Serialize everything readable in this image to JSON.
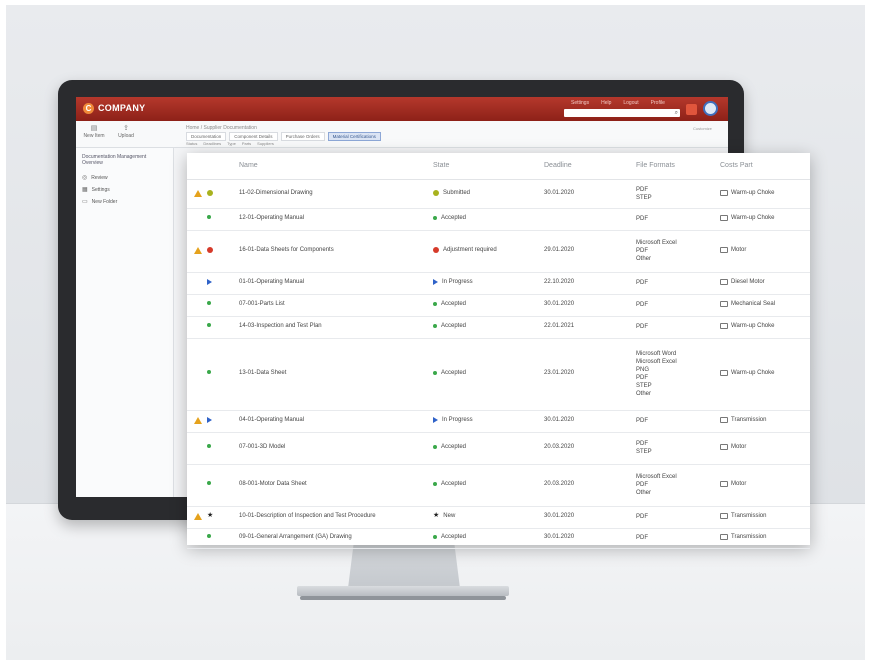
{
  "app": {
    "logo_text": "COMPANY",
    "top_links": [
      "Settings",
      "Help",
      "Logout",
      "Profile"
    ],
    "colors": {
      "brand": "#a22c22",
      "accent": "#3f6ebc"
    }
  },
  "toolbar": {
    "buttons": [
      {
        "label": "New Item",
        "icon": "document-icon"
      },
      {
        "label": "Upload",
        "icon": "upload-icon"
      }
    ],
    "breadcrumb": "Home / Supplier Documentation",
    "tabs": [
      "Documentation",
      "Component Details",
      "Purchase Orders",
      "Material Certifications"
    ],
    "active_tab": 3,
    "subtabs": [
      "Status",
      "Deadlines",
      "Type",
      "Parts",
      "Suppliers"
    ],
    "top_right_label": "Customize"
  },
  "sidebar": {
    "title": "Documentation Management Overview",
    "items": [
      {
        "label": "Review",
        "icon": "review-icon"
      },
      {
        "label": "Settings",
        "icon": "grid-icon"
      },
      {
        "label": "New Folder",
        "icon": "folder-icon"
      }
    ]
  },
  "table": {
    "headers": [
      "Name",
      "State",
      "Deadline",
      "File Formats",
      "Costs Part"
    ],
    "rows": [
      {
        "warning": true,
        "status_color": "#a8b21e",
        "dot_shape": "circle",
        "name": "11-02-Dimensional Drawing",
        "state": "Submitted",
        "deadline": "30.01.2020",
        "formats": [
          "PDF",
          "STEP"
        ],
        "part": "Warm-up Choke"
      },
      {
        "warning": false,
        "status_color": "#3aa84a",
        "dot_shape": "small",
        "name": "12-01-Operating Manual",
        "state": "Accepted",
        "deadline": "",
        "formats": [
          "PDF"
        ],
        "part": "Warm-up Choke"
      },
      {
        "warning": true,
        "status_color": "#d63a2a",
        "dot_shape": "circle",
        "name": "16-01-Data Sheets for Components",
        "state": "Adjustment required",
        "deadline": "29.01.2020",
        "formats": [
          "Microsoft Excel",
          "PDF",
          "Other"
        ],
        "part": "Motor"
      },
      {
        "warning": false,
        "status_color": "#2f62c8",
        "dot_shape": "arrow",
        "name": "01-01-Operating Manual",
        "state": "In Progress",
        "deadline": "22.10.2020",
        "formats": [
          "PDF"
        ],
        "part": "Diesel Motor"
      },
      {
        "warning": false,
        "status_color": "#3aa84a",
        "dot_shape": "small",
        "name": "07-001-Parts List",
        "state": "Accepted",
        "deadline": "30.01.2020",
        "formats": [
          "PDF"
        ],
        "part": "Mechanical Seal"
      },
      {
        "warning": false,
        "status_color": "#3aa84a",
        "dot_shape": "small",
        "name": "14-03-Inspection and Test Plan",
        "state": "Accepted",
        "deadline": "22.01.2021",
        "formats": [
          "PDF"
        ],
        "part": "Warm-up Choke"
      },
      {
        "warning": false,
        "status_color": "#3aa84a",
        "dot_shape": "small",
        "name": "13-01-Data Sheet",
        "state": "Accepted",
        "deadline": "23.01.2020",
        "formats": [
          "Microsoft Word",
          "Microsoft Excel",
          "PNG",
          "PDF",
          "STEP",
          "Other"
        ],
        "part": "Warm-up Choke"
      },
      {
        "warning": true,
        "status_color": "#2f62c8",
        "dot_shape": "arrow",
        "name": "04-01-Operating Manual",
        "state": "In Progress",
        "deadline": "30.01.2020",
        "formats": [
          "PDF"
        ],
        "part": "Transmission"
      },
      {
        "warning": false,
        "status_color": "#3aa84a",
        "dot_shape": "small",
        "name": "07-001-3D Model",
        "state": "Accepted",
        "deadline": "20.03.2020",
        "formats": [
          "PDF",
          "STEP"
        ],
        "part": "Motor"
      },
      {
        "warning": false,
        "status_color": "#3aa84a",
        "dot_shape": "small",
        "name": "08-001-Motor Data Sheet",
        "state": "Accepted",
        "deadline": "20.03.2020",
        "formats": [
          "Microsoft Excel",
          "PDF",
          "Other"
        ],
        "part": "Motor"
      },
      {
        "warning": true,
        "status_color": "#222222",
        "dot_shape": "star",
        "name": "10-01-Description of Inspection and Test Procedure",
        "state": "New",
        "deadline": "30.01.2020",
        "formats": [
          "PDF"
        ],
        "part": "Transmission"
      },
      {
        "warning": false,
        "status_color": "#3aa84a",
        "dot_shape": "small",
        "name": "09-01-General Arrangement (GA) Drawing",
        "state": "Accepted",
        "deadline": "30.01.2020",
        "formats": [
          "PDF"
        ],
        "part": "Transmission"
      }
    ]
  }
}
